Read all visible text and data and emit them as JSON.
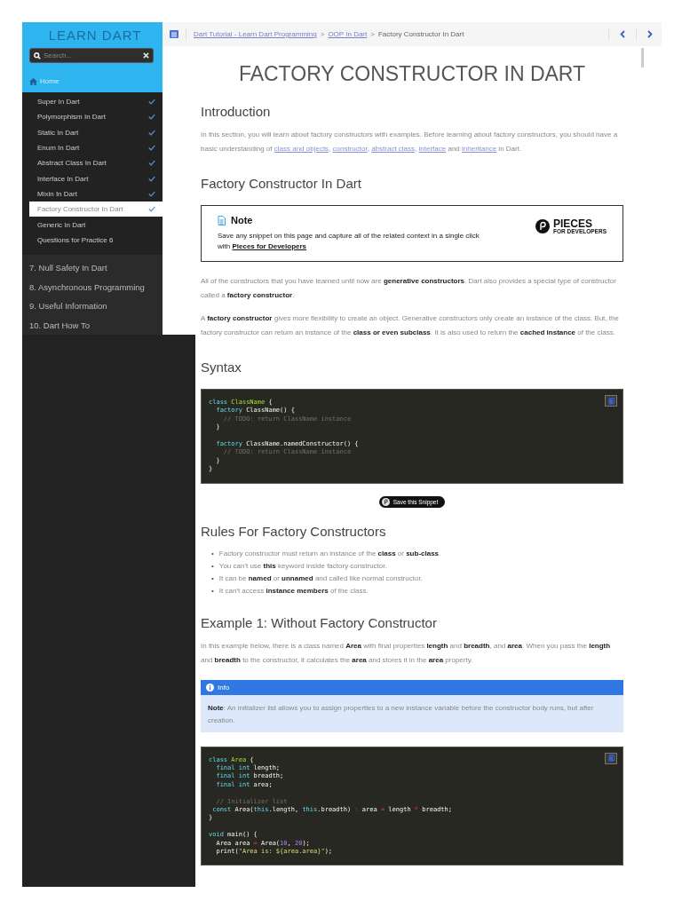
{
  "sidebar": {
    "title": "LEARN DART",
    "search": {
      "placeholder": "Search..."
    },
    "home": "Home",
    "lessons": [
      {
        "label": "Super In Dart",
        "checked": true,
        "selected": false
      },
      {
        "label": "Polymorphism In Dart",
        "checked": true,
        "selected": false
      },
      {
        "label": "Static In Dart",
        "checked": true,
        "selected": false
      },
      {
        "label": "Enum In Dart",
        "checked": true,
        "selected": false
      },
      {
        "label": "Abstract Class In Dart",
        "checked": true,
        "selected": false
      },
      {
        "label": "Interface In Dart",
        "checked": true,
        "selected": false
      },
      {
        "label": "Mixin In Dart",
        "checked": true,
        "selected": false
      },
      {
        "label": "Factory Constructor In Dart",
        "checked": true,
        "selected": true
      },
      {
        "label": "Generic In Dart",
        "checked": false,
        "selected": false
      },
      {
        "label": "Questions for Practice 6",
        "checked": false,
        "selected": false
      }
    ],
    "chapters": [
      "7. Null Safety In Dart",
      "8. Asynchronous Programming",
      "9. Useful Information",
      "10. Dart How To"
    ]
  },
  "breadcrumb": [
    {
      "kind": "link",
      "text": "Dart Tutorial - Learn Dart Programming"
    },
    {
      "kind": "sep",
      "text": ">"
    },
    {
      "kind": "link",
      "text": "OOP In Dart"
    },
    {
      "kind": "sep",
      "text": ">"
    },
    {
      "kind": "current",
      "text": "Factory Constructor In Dart"
    }
  ],
  "article": {
    "title": "FACTORY CONSTRUCTOR IN DART",
    "blocks": [
      {
        "kind": "h2",
        "text": "Introduction"
      },
      {
        "kind": "p",
        "parts": [
          {
            "kind": "text",
            "text": "In this section, you will learn about factory constructors with examples. Before learning about factory constructors, you should have a basic understanding of "
          },
          {
            "kind": "link",
            "text": "class and objects"
          },
          {
            "kind": "text",
            "text": ", "
          },
          {
            "kind": "link",
            "text": "constructor"
          },
          {
            "kind": "text",
            "text": ", "
          },
          {
            "kind": "link",
            "text": "abstract class"
          },
          {
            "kind": "text",
            "text": ", "
          },
          {
            "kind": "link",
            "text": "interface"
          },
          {
            "kind": "text",
            "text": " and "
          },
          {
            "kind": "link",
            "text": "inheritance"
          },
          {
            "kind": "text",
            "text": " in Dart."
          }
        ]
      },
      {
        "kind": "h2",
        "text": "Factory Constructor In Dart"
      },
      {
        "kind": "note",
        "title": "Note",
        "parts": [
          {
            "kind": "text",
            "text": "Save any snippet on this page and capture all of the related context in a single click with "
          },
          {
            "kind": "link",
            "text": "Pieces for Developers"
          }
        ],
        "brand": "PIECES",
        "tagline": "FOR DEVELOPERS"
      },
      {
        "kind": "p",
        "parts": [
          {
            "kind": "text",
            "text": "All of the constructors that you have learned until now are **generative constructors**. Dart also provides a special type of constructor called a **factory constructor**."
          }
        ]
      },
      {
        "kind": "p",
        "parts": [
          {
            "kind": "text",
            "text": "A **factory constructor** gives more flexibility to create an object. Generative constructors only create an instance of the class. But, the factory constructor can return an instance of the **class or even subclass**. It is also used to return the **cached instance** of the class."
          }
        ]
      },
      {
        "kind": "h2",
        "text": "Syntax"
      },
      {
        "kind": "code",
        "lines": [
          {
            "kind": "code",
            "tokens": [
              {
                "kind": "kw",
                "text": "class "
              },
              {
                "kind": "type",
                "text": "ClassName"
              },
              {
                "kind": "plain",
                "text": " {"
              }
            ]
          },
          {
            "kind": "code",
            "tokens": [
              {
                "kind": "kw",
                "text": "  factory "
              },
              {
                "kind": "plain",
                "text": "ClassName() {"
              }
            ]
          },
          {
            "kind": "code",
            "tokens": [
              {
                "kind": "comment",
                "text": "    // TODO: return ClassName instance"
              }
            ]
          },
          {
            "kind": "code",
            "tokens": [
              {
                "kind": "plain",
                "text": "  }"
              }
            ]
          },
          {
            "kind": "blank"
          },
          {
            "kind": "code",
            "tokens": [
              {
                "kind": "kw",
                "text": "  factory "
              },
              {
                "kind": "plain",
                "text": "ClassName.namedConstructor() {"
              }
            ]
          },
          {
            "kind": "code",
            "tokens": [
              {
                "kind": "comment",
                "text": "    // TODO: return ClassName instance"
              }
            ]
          },
          {
            "kind": "code",
            "tokens": [
              {
                "kind": "plain",
                "text": "  }"
              }
            ]
          },
          {
            "kind": "code",
            "tokens": [
              {
                "kind": "plain",
                "text": "}"
              }
            ]
          }
        ]
      },
      {
        "kind": "snippet",
        "text": "Save this Snippet"
      },
      {
        "kind": "h2",
        "text": "Rules For Factory Constructors"
      },
      {
        "kind": "ul",
        "marker": "•",
        "items": [
          "Factory constructor must return an instance of the **class** or **sub-class**.",
          "You can't use **this** keyword inside factory constructor.",
          "It can be **named** or **unnamed** and called like normal constructor.",
          "It can't access **instance members** of the class."
        ]
      },
      {
        "kind": "h2",
        "text": "Example 1: Without Factory Constructor"
      },
      {
        "kind": "p",
        "parts": [
          {
            "kind": "text",
            "text": "In this example below, there is a class named **Area** with final properties **length** and **breadth**, and **area**. When you pass the **length** and **breadth** to the constructor, it calculates the **area** and stores it in the **area** property."
          }
        ]
      },
      {
        "kind": "info",
        "title": "Info",
        "text": "**Note**: An initializer list allows you to assign properties to a new instance variable before the constructor body runs, but after creation."
      },
      {
        "kind": "code",
        "lines": [
          {
            "kind": "code",
            "tokens": [
              {
                "kind": "kw",
                "text": "class "
              },
              {
                "kind": "type",
                "text": "Area"
              },
              {
                "kind": "plain",
                "text": " {"
              }
            ]
          },
          {
            "kind": "code",
            "tokens": [
              {
                "kind": "kw",
                "text": "  final int "
              },
              {
                "kind": "plain",
                "text": "length;"
              }
            ]
          },
          {
            "kind": "code",
            "tokens": [
              {
                "kind": "kw",
                "text": "  final int "
              },
              {
                "kind": "plain",
                "text": "breadth;"
              }
            ]
          },
          {
            "kind": "code",
            "tokens": [
              {
                "kind": "kw",
                "text": "  final int "
              },
              {
                "kind": "plain",
                "text": "area;"
              }
            ]
          },
          {
            "kind": "blank"
          },
          {
            "kind": "code",
            "tokens": [
              {
                "kind": "comment",
                "text": "  // Initializer list"
              }
            ]
          },
          {
            "kind": "code",
            "tokens": [
              {
                "kind": "kw",
                "text": " const "
              },
              {
                "kind": "plain",
                "text": "Area("
              },
              {
                "kind": "kw",
                "text": "this"
              },
              {
                "kind": "plain",
                "text": ".length, "
              },
              {
                "kind": "kw",
                "text": "this"
              },
              {
                "kind": "plain",
                "text": ".breadth) "
              },
              {
                "kind": "op",
                "text": ":"
              },
              {
                "kind": "plain",
                "text": " area "
              },
              {
                "kind": "op",
                "text": "="
              },
              {
                "kind": "plain",
                "text": " length "
              },
              {
                "kind": "op",
                "text": "*"
              },
              {
                "kind": "plain",
                "text": " breadth;"
              }
            ]
          },
          {
            "kind": "code",
            "tokens": [
              {
                "kind": "plain",
                "text": "}"
              }
            ]
          },
          {
            "kind": "blank"
          },
          {
            "kind": "code",
            "tokens": [
              {
                "kind": "kw",
                "text": "void "
              },
              {
                "kind": "plain",
                "text": "main() {"
              }
            ]
          },
          {
            "kind": "code",
            "tokens": [
              {
                "kind": "plain",
                "text": "  Area area "
              },
              {
                "kind": "op",
                "text": "="
              },
              {
                "kind": "plain",
                "text": " Area("
              },
              {
                "kind": "num",
                "text": "10"
              },
              {
                "kind": "plain",
                "text": ", "
              },
              {
                "kind": "num",
                "text": "20"
              },
              {
                "kind": "plain",
                "text": ");"
              }
            ]
          },
          {
            "kind": "code",
            "tokens": [
              {
                "kind": "plain",
                "text": "  print("
              },
              {
                "kind": "str",
                "text": "\"Area is: ${area.area}\""
              },
              {
                "kind": "plain",
                "text": ");"
              }
            ]
          }
        ]
      }
    ]
  }
}
